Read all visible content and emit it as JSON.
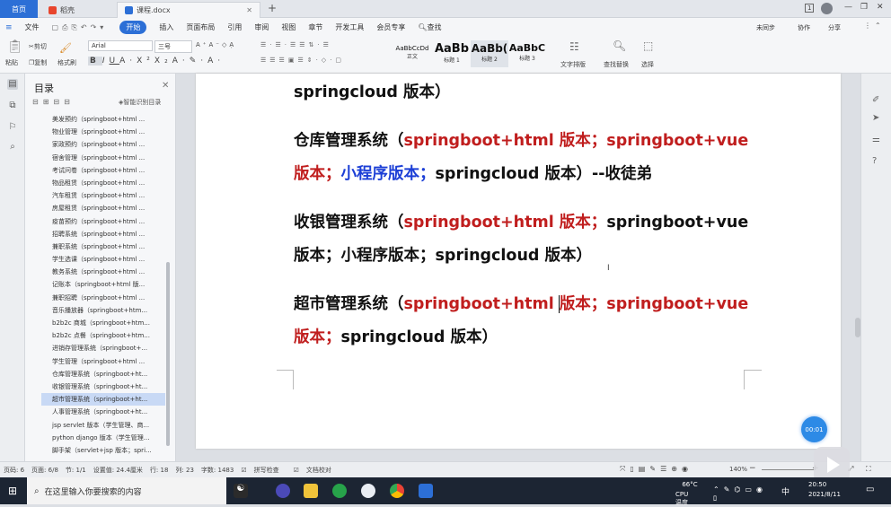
{
  "tabs": [
    {
      "label": "首页"
    },
    {
      "label": "稻壳"
    },
    {
      "label": "课程.docx"
    }
  ],
  "window_badge": "1",
  "menu": [
    "文件",
    "开始",
    "插入",
    "页面布局",
    "引用",
    "审阅",
    "视图",
    "章节",
    "开发工具",
    "会员专享"
  ],
  "menu_search": "查找",
  "menu_right": {
    "sync": "未同步",
    "collab": "协作",
    "share": "分享"
  },
  "toolbar": {
    "paste": "粘贴",
    "cut": "剪切",
    "copy": "复制",
    "format_painter": "格式刷",
    "font": "Arial",
    "font_size": "三号",
    "styles": [
      {
        "preview": "AaBbCcDd",
        "name": "正文"
      },
      {
        "preview": "AaBb",
        "name": "标题 1"
      },
      {
        "preview": "AaBb(",
        "name": "标题 2"
      },
      {
        "preview": "AaBbC",
        "name": "标题 3"
      }
    ],
    "text_layout": "文字排版",
    "find_replace": "查找替换",
    "select": "选择"
  },
  "toc": {
    "title": "目录",
    "smart": "智能识别目录",
    "items": [
      "美发预约（springboot+html ...",
      "物业管理（springboot+html ...",
      "家政预约（springboot+html ...",
      "宿舍管理（springboot+html ...",
      "考试问卷（springboot+html ...",
      "物品租赁（springboot+html ...",
      "汽车租赁（springboot+html ...",
      "房屋租赁（springboot+html ...",
      "疫苗预约（springboot+html ...",
      "招聘系统（springboot+html ...",
      "兼职系统（springboot+html ...",
      "学生选课（springboot+html ...",
      "教务系统（springboot+html ...",
      "记账本（springboot+html 版...",
      "兼职招聘（springboot+html ...",
      "音乐播放器（springboot+htm...",
      "b2b2c 商城（springboot+htm...",
      "b2b2c 点餐（springboot+htm...",
      "进销存管理系统（springboot+...",
      "学生管理（springboot+html ...",
      "仓库管理系统（springboot+ht...",
      "收银管理系统（springboot+ht...",
      "超市管理系统（springboot+ht...",
      "人事管理系统（springboot+ht...",
      "jsp servlet 版本（学生管理、商...",
      "python django 版本（学生管理...",
      "脚手架（servlet+jsp 版本；spri..."
    ],
    "selected_index": 22
  },
  "doc": {
    "line0": "springcloud 版本）",
    "p1": {
      "a": "仓库管理系统（",
      "b": "springboot+html 版本；springboot+vue",
      "c": "版本；",
      "d": "小程序版本；",
      "e": "springcloud 版本）--收徒弟"
    },
    "p2": {
      "a": "收银管理系统（",
      "b": "springboot+html 版本；",
      "c": "springboot+vue",
      "d": "版本；小程序版本；springcloud 版本）"
    },
    "p3": {
      "a": "超市管理系统（",
      "b": "springboot+html ",
      "c": "版本；springboot+vue",
      "d": "版本；",
      "e": "springcloud 版本）"
    }
  },
  "timer": "00:01",
  "status": {
    "page": "页码: 6",
    "pages": "页面: 6/8",
    "section": "节: 1/1",
    "setting": "设置值: 24.4厘米",
    "row": "行: 18",
    "col": "列: 23",
    "words": "字数: 1483",
    "spell": "拼写检查",
    "proof": "文档校对",
    "zoom": "140%"
  },
  "taskbar": {
    "search_placeholder": "在这里输入你要搜索的内容",
    "temp": "66°C",
    "temp_label": "CPU温度",
    "time": "20:50",
    "date": "2021/8/11",
    "ime": "中"
  }
}
